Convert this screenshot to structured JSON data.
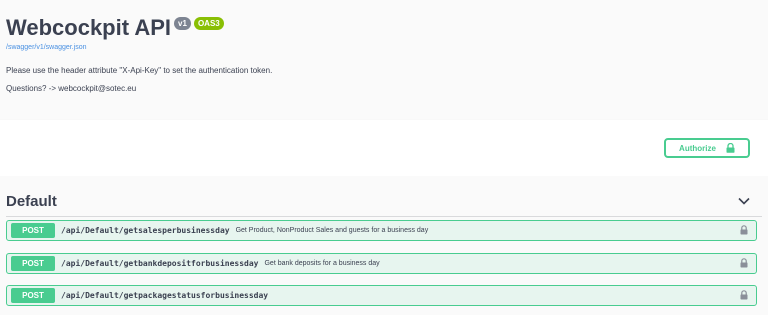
{
  "info": {
    "title": "Webcockpit API",
    "version_badge": "v1",
    "oas_badge": "OAS3",
    "spec_url": "/swagger/v1/swagger.json",
    "description_line1": "Please use the header attribute \"X-Api-Key\" to set the authentication token.",
    "description_line2": "Questions? -> webcockpit@sotec.eu"
  },
  "scheme": {
    "authorize_label": "Authorize"
  },
  "section": {
    "title": "Default"
  },
  "operations": [
    {
      "method": "POST",
      "path": "/api/Default/getsalesperbusinessday",
      "summary": "Get Product, NonProduct Sales and guests for a business day"
    },
    {
      "method": "POST",
      "path": "/api/Default/getbankdepositforbusinessday",
      "summary": "Get bank deposits for a business day"
    },
    {
      "method": "POST",
      "path": "/api/Default/getpackagestatusforbusinessday",
      "summary": ""
    }
  ],
  "colors": {
    "post_green": "#49cc90",
    "version_badge": "#7d8492",
    "oas_badge": "#89bf04",
    "link_blue": "#4990e2"
  },
  "icons": {
    "authorize": "lock-icon",
    "section_toggle": "chevron-down-icon",
    "operation_lock": "lock-icon"
  }
}
